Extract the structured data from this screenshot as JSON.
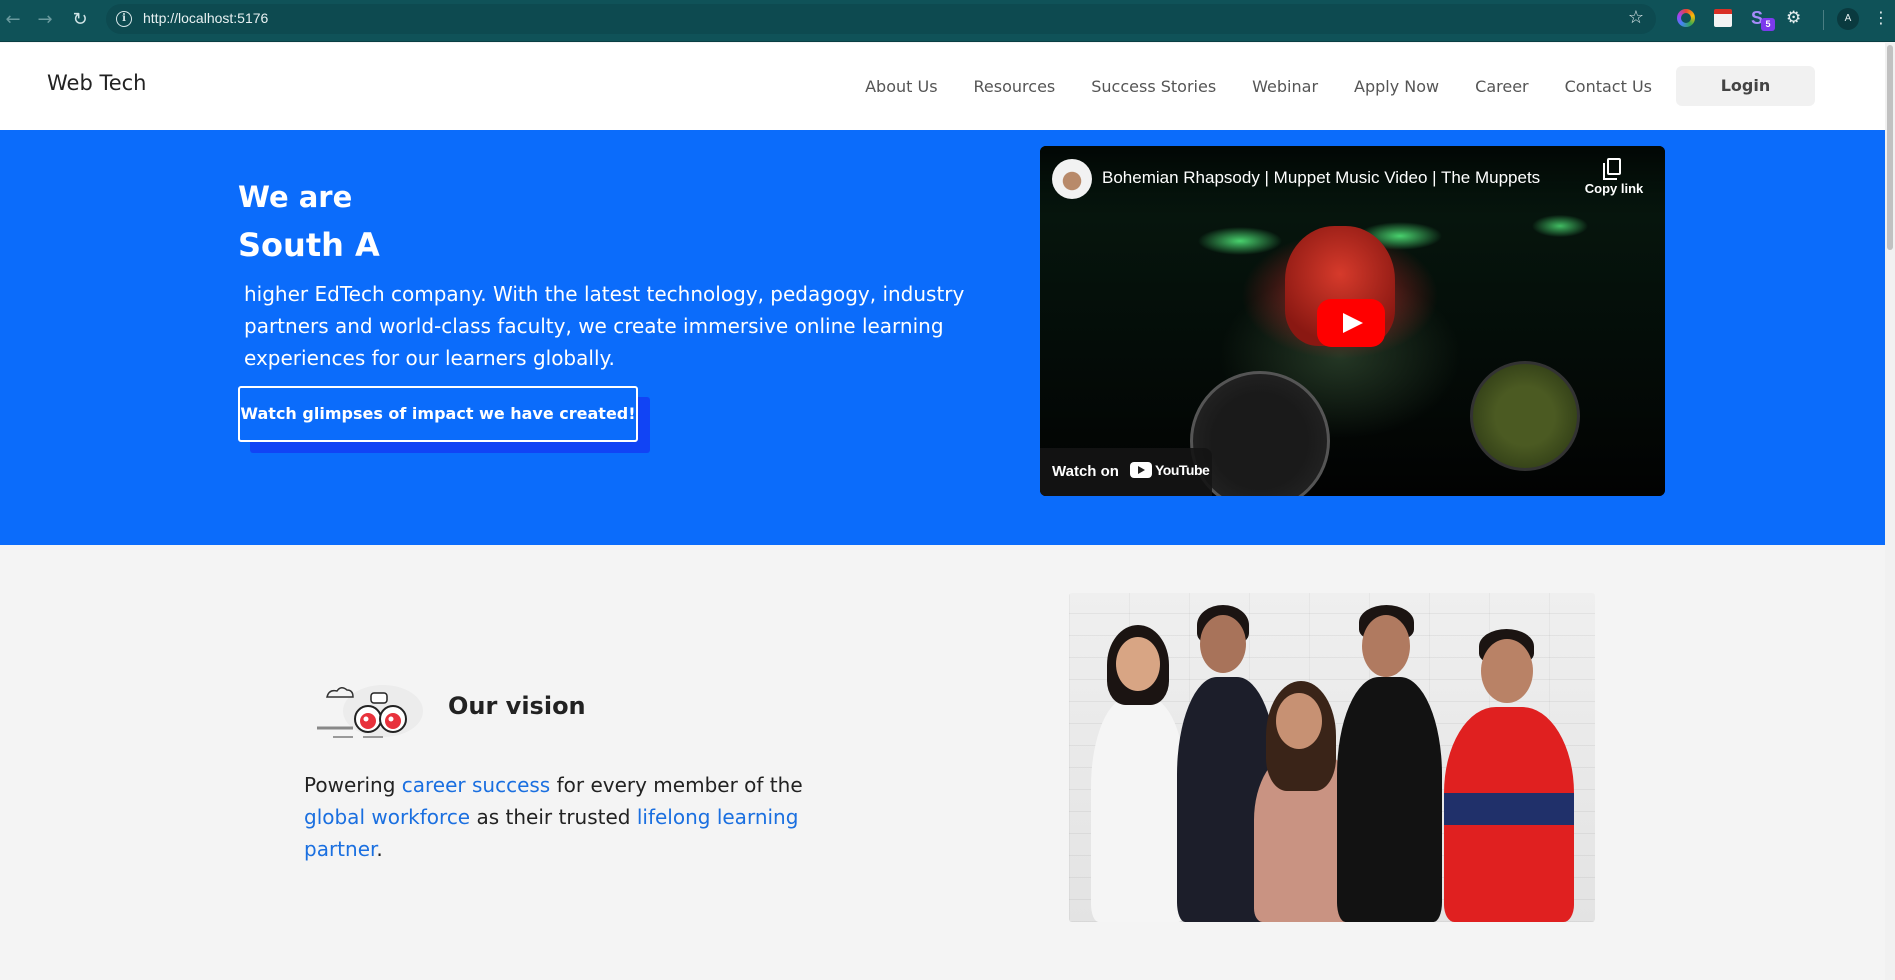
{
  "browser": {
    "url_prefix": "http://",
    "url_host": "localhost:5176",
    "extensions": [
      "color-picker-icon",
      "calendar-icon",
      "s-extension-icon",
      "puzzle-icon"
    ],
    "extension_badge": "5",
    "profile_initial": "A"
  },
  "header": {
    "brand": "Web Tech",
    "nav": [
      "About Us",
      "Resources",
      "Success Stories",
      "Webinar",
      "Apply Now",
      "Career",
      "Contact Us"
    ],
    "login": "Login"
  },
  "hero": {
    "title_line1": "We are",
    "title_line2": "South A",
    "description": "higher EdTech company. With the latest technology, pedagogy, industry partners and world-class faculty, we create immersive online learning experiences for our learners globally.",
    "cta": "Watch glimpses of impact we have created!",
    "bg_color": "#0b6cfb"
  },
  "video": {
    "title": "Bohemian Rhapsody | Muppet Music Video | The Muppets",
    "copy_link": "Copy link",
    "watch_on": "Watch on",
    "youtube": "YouTube"
  },
  "vision": {
    "heading": "Our vision",
    "text_parts": [
      "Powering ",
      "career success",
      " for every member of the ",
      "global workforce",
      " as their trusted ",
      "lifelong learning partner",
      "."
    ],
    "highlight_color": "#1a6fe0"
  }
}
